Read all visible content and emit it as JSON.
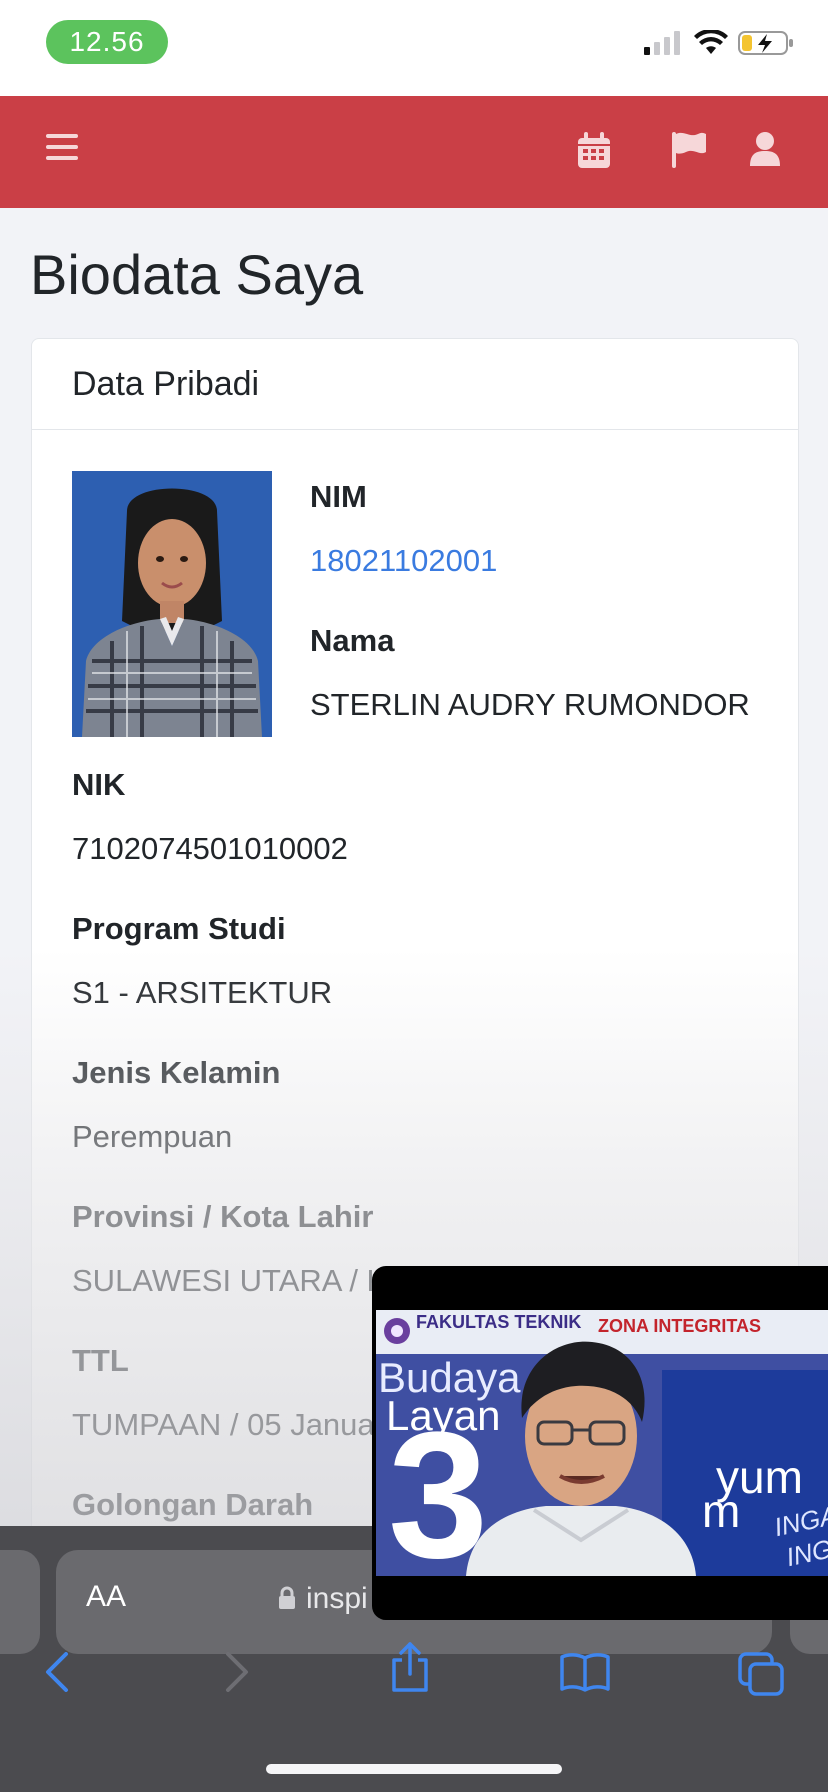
{
  "status_bar": {
    "time": "12.56"
  },
  "header": {
    "menu_icon": "hamburger-menu-icon",
    "calendar_icon": "calendar-icon",
    "flag_icon": "flag-icon",
    "user_icon": "user-icon"
  },
  "page": {
    "title": "Biodata Saya"
  },
  "card": {
    "header": "Data Pribadi",
    "fields": {
      "nim_label": "NIM",
      "nim_value": "18021102001",
      "nama_label": "Nama",
      "nama_value": "STERLIN AUDRY RUMONDOR",
      "nik_label": "NIK",
      "nik_value": "7102074501010002",
      "prodi_label": "Program Studi",
      "prodi_value": "S1 - ARSITEKTUR",
      "jk_label": "Jenis Kelamin",
      "jk_value": "Perempuan",
      "prov_label": "Provinsi / Kota Lahir",
      "prov_value": "SULAWESI UTARA / K",
      "ttl_label": "TTL",
      "ttl_value": "TUMPAAN / 05 Janua",
      "goldar_label": "Golongan Darah"
    }
  },
  "video_overlay": {
    "logo_text": "FAKULTAS TEKNIK",
    "zona_text": "ZONA INTEGRITAS",
    "line1": "Budaya",
    "line2": "Layan",
    "big_number": "3",
    "right_text_1": "yum",
    "right_text_2": "m",
    "inga_1": "INGA",
    "inga_2": "INGA"
  },
  "browser": {
    "text_size_label": "AA",
    "url": "inspi",
    "back_icon": "chevron-left-icon",
    "forward_icon": "chevron-right-icon",
    "share_icon": "share-icon",
    "bookmarks_icon": "book-icon",
    "tabs_icon": "tabs-icon"
  },
  "colors": {
    "navbar": "#ca3f46",
    "link": "#3a7be0",
    "time_pill": "#5cc35d"
  }
}
